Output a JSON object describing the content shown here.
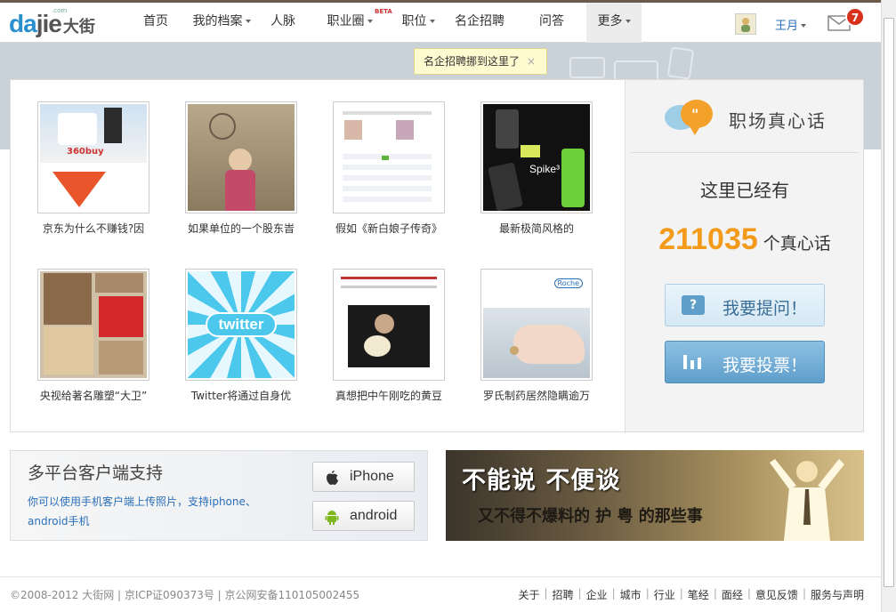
{
  "logo": {
    "en_prefix": "da",
    "en_rest": "jie",
    "zh": "大街",
    "com": ".com"
  },
  "nav": {
    "items": [
      {
        "label": "首页",
        "caret": false
      },
      {
        "label": "我的档案",
        "caret": true
      },
      {
        "label": "人脉",
        "caret": false
      },
      {
        "label": "职业圈",
        "caret": true,
        "badge": "BETA"
      },
      {
        "label": "职位",
        "caret": true
      },
      {
        "label": "名企招聘",
        "caret": false
      },
      {
        "label": "问答",
        "caret": false
      },
      {
        "label": "更多",
        "caret": true
      }
    ]
  },
  "user": {
    "name": "王月",
    "mail_count": "7"
  },
  "tooltip": {
    "text": "名企招聘挪到这里了",
    "close": "×"
  },
  "grid": {
    "items": [
      {
        "caption": "京东为什么不赚钱?因"
      },
      {
        "caption": "如果单位的一个股东旹"
      },
      {
        "caption": "假如《新白娘子传奇》"
      },
      {
        "caption": "最新极简风格的"
      },
      {
        "caption": "央视给著名雕塑“大卫”"
      },
      {
        "caption": "Twitter将通过自身优"
      },
      {
        "caption": "真想把中午刚吃的黄豆"
      },
      {
        "caption": "罗氏制药居然隐瞒逾万"
      }
    ],
    "twitter_logo_text": "twitter",
    "phone_label": "Spike³",
    "roche_label": "Roche",
    "jd_text": "360buy"
  },
  "heart": {
    "title": "职场真心话",
    "already": "这里已经有",
    "count": "211035",
    "unit": "个真心话",
    "ask_label": "我要提问！",
    "vote_label": "我要投票！"
  },
  "platform": {
    "title": "多平台客户端支持",
    "desc": "你可以使用手机客户端上传照片，支持iphone、android手机",
    "iphone_label": "iPhone",
    "android_label": "android"
  },
  "promo": {
    "line1": "不能说 不便谈",
    "line2": "又不得不爆料的 护 粤 的那些事"
  },
  "footer": {
    "copyright": "©2008-2012 大街网 | 京ICP证090373号 | 京公网安备110105002455",
    "links": [
      "关于",
      "招聘",
      "企业",
      "城市",
      "行业",
      "笔经",
      "面经",
      "意见反馈",
      "服务与声明"
    ]
  },
  "colors": {
    "accent": "#f39a1a",
    "link": "#2a6fb8",
    "badge": "#d8321c"
  }
}
